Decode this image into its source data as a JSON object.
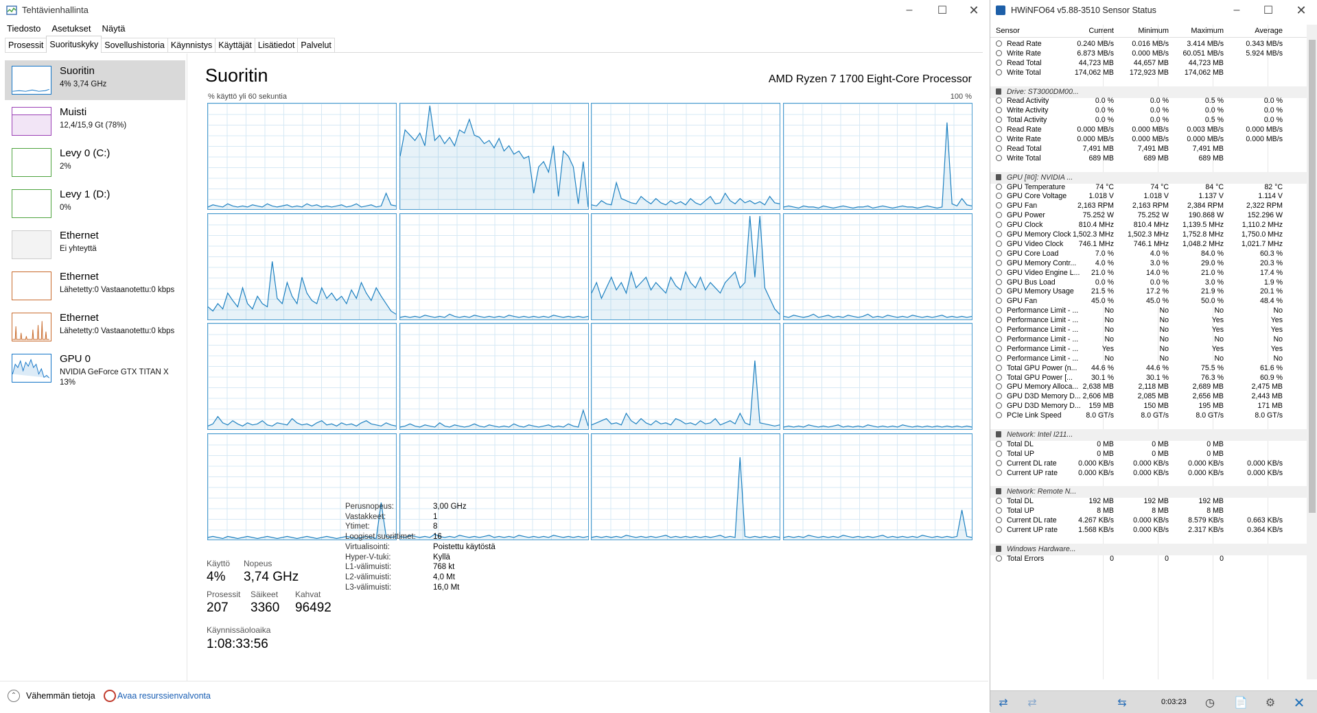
{
  "task_manager": {
    "title": "Tehtävienhallinta",
    "menu": [
      "Tiedosto",
      "Asetukset",
      "Näytä"
    ],
    "tabs": [
      "Prosessit",
      "Suorituskyky",
      "Sovellushistoria",
      "Käynnistys",
      "Käyttäjät",
      "Lisätiedot",
      "Palvelut"
    ],
    "resources": [
      {
        "name": "Suoritin",
        "sub": "4% 3,74 GHz",
        "color": "#1174c7"
      },
      {
        "name": "Muisti",
        "sub": "12,4/15,9 Gt (78%)",
        "color": "#9b3fb5"
      },
      {
        "name": "Levy 0 (C:)",
        "sub": "2%",
        "color": "#4da33d"
      },
      {
        "name": "Levy 1 (D:)",
        "sub": "0%",
        "color": "#4da33d"
      },
      {
        "name": "Ethernet",
        "sub": "Ei yhteyttä",
        "color": "#bbbbbb"
      },
      {
        "name": "Ethernet",
        "sub": "Lähetetty:0 Vastaanotettu:0 kbps",
        "color": "#c8692a"
      },
      {
        "name": "Ethernet",
        "sub": "Lähetetty:0 Vastaanotettu:0 kbps",
        "color": "#c8692a"
      },
      {
        "name": "GPU 0",
        "sub": "NVIDIA GeForce GTX TITAN X",
        "sub2": "13%",
        "color": "#1174c7"
      }
    ],
    "cpu": {
      "title": "Suoritin",
      "model": "AMD Ryzen 7 1700 Eight-Core Processor",
      "graph_caption": "% käyttö yli 60 sekuntia",
      "graph_max": "100 %",
      "stats": {
        "usage_label": "Käyttö",
        "usage": "4%",
        "speed_label": "Nopeus",
        "speed": "3,74 GHz",
        "processes_label": "Prosessit",
        "processes": "207",
        "threads_label": "Säikeet",
        "threads": "3360",
        "handles_label": "Kahvat",
        "handles": "96492",
        "uptime_label": "Käynnissäoloaika",
        "uptime": "1:08:33:56"
      },
      "details": [
        [
          "Perusnopeus:",
          "3,00 GHz"
        ],
        [
          "Vastakkeet:",
          "1"
        ],
        [
          "Ytimet:",
          "8"
        ],
        [
          "Loogiset suorittimet:",
          "16"
        ],
        [
          "Virtualisointi:",
          "Poistettu käytöstä"
        ],
        [
          "Hyper-V-tuki:",
          "Kyllä"
        ],
        [
          "L1-välimuisti:",
          "768 kt"
        ],
        [
          "L2-välimuisti:",
          "4,0 Mt"
        ],
        [
          "L3-välimuisti:",
          "16,0 Mt"
        ]
      ],
      "core_usage_series": [
        [
          2,
          4,
          3,
          2,
          5,
          3,
          2,
          3,
          2,
          4,
          3,
          2,
          5,
          3,
          2,
          3,
          4,
          2,
          3,
          2,
          5,
          3,
          4,
          2,
          3,
          2,
          3,
          4,
          2,
          3,
          5,
          2,
          3,
          4,
          2,
          3,
          15,
          4,
          3
        ],
        [
          50,
          75,
          70,
          65,
          72,
          60,
          98,
          65,
          70,
          62,
          68,
          60,
          75,
          72,
          85,
          70,
          68,
          62,
          65,
          58,
          67,
          55,
          60,
          52,
          55,
          48,
          50,
          15,
          40,
          45,
          35,
          60,
          12,
          55,
          50,
          40,
          5,
          45,
          2
        ],
        [
          4,
          3,
          8,
          5,
          4,
          25,
          10,
          8,
          6,
          5,
          12,
          8,
          5,
          10,
          6,
          4,
          8,
          5,
          7,
          4,
          10,
          6,
          4,
          8,
          12,
          5,
          6,
          15,
          8,
          5,
          10,
          6,
          8,
          5,
          7,
          4,
          12,
          6,
          5
        ],
        [
          2,
          3,
          2,
          1,
          3,
          2,
          2,
          1,
          3,
          2,
          1,
          2,
          3,
          2,
          1,
          2,
          2,
          3,
          1,
          2,
          3,
          2,
          1,
          2,
          3,
          2,
          2,
          1,
          2,
          3,
          2,
          1,
          2,
          82,
          5,
          3,
          10,
          4,
          3
        ],
        [
          12,
          8,
          15,
          10,
          25,
          18,
          12,
          30,
          15,
          10,
          22,
          15,
          12,
          55,
          20,
          15,
          35,
          22,
          15,
          40,
          25,
          18,
          15,
          30,
          20,
          25,
          18,
          22,
          15,
          28,
          20,
          35,
          25,
          18,
          30,
          22,
          15,
          8,
          5
        ],
        [
          2,
          3,
          2,
          3,
          2,
          4,
          3,
          2,
          3,
          2,
          5,
          3,
          2,
          3,
          2,
          4,
          3,
          2,
          3,
          2,
          3,
          2,
          4,
          3,
          2,
          3,
          2,
          3,
          2,
          3,
          2,
          4,
          3,
          2,
          3,
          2,
          3,
          2,
          3
        ],
        [
          25,
          35,
          20,
          30,
          40,
          28,
          35,
          25,
          45,
          30,
          35,
          40,
          28,
          35,
          30,
          25,
          40,
          32,
          28,
          45,
          35,
          30,
          40,
          28,
          35,
          30,
          25,
          35,
          40,
          45,
          30,
          35,
          98,
          40,
          98,
          30,
          20,
          10,
          5
        ],
        [
          3,
          2,
          4,
          3,
          2,
          3,
          5,
          2,
          3,
          4,
          2,
          3,
          2,
          4,
          3,
          2,
          3,
          5,
          2,
          3,
          2,
          4,
          3,
          2,
          3,
          2,
          4,
          3,
          2,
          3,
          2,
          3,
          4,
          2,
          3,
          2,
          3,
          2,
          3
        ],
        [
          3,
          5,
          12,
          6,
          4,
          8,
          5,
          3,
          6,
          4,
          5,
          8,
          4,
          3,
          6,
          5,
          4,
          10,
          6,
          4,
          5,
          3,
          6,
          8,
          4,
          5,
          3,
          6,
          4,
          5,
          3,
          6,
          8,
          5,
          4,
          3,
          6,
          4,
          3
        ],
        [
          2,
          3,
          5,
          3,
          2,
          4,
          3,
          2,
          6,
          3,
          2,
          4,
          3,
          2,
          3,
          5,
          3,
          2,
          4,
          3,
          2,
          3,
          2,
          5,
          3,
          2,
          4,
          3,
          2,
          3,
          4,
          2,
          3,
          2,
          5,
          3,
          2,
          18,
          3
        ],
        [
          4,
          6,
          8,
          10,
          5,
          6,
          4,
          15,
          8,
          5,
          10,
          6,
          4,
          8,
          5,
          6,
          4,
          10,
          8,
          5,
          6,
          4,
          8,
          5,
          6,
          10,
          4,
          6,
          8,
          5,
          15,
          6,
          4,
          65,
          6,
          5,
          4,
          3,
          4
        ],
        [
          2,
          3,
          2,
          3,
          2,
          4,
          3,
          2,
          3,
          2,
          3,
          4,
          2,
          3,
          2,
          3,
          2,
          4,
          3,
          2,
          3,
          2,
          3,
          2,
          4,
          3,
          2,
          3,
          2,
          3,
          2,
          3,
          2,
          3,
          2,
          3,
          2,
          3,
          2
        ],
        [
          2,
          3,
          2,
          1,
          3,
          2,
          1,
          2,
          3,
          2,
          1,
          2,
          3,
          2,
          1,
          2,
          3,
          2,
          1,
          2,
          3,
          2,
          1,
          2,
          3,
          2,
          1,
          2,
          3,
          2,
          1,
          2,
          3,
          2,
          1,
          35,
          3,
          2,
          3
        ],
        [
          3,
          2,
          4,
          3,
          2,
          3,
          2,
          5,
          3,
          2,
          3,
          2,
          4,
          3,
          2,
          3,
          2,
          3,
          4,
          2,
          3,
          2,
          3,
          2,
          4,
          3,
          2,
          3,
          2,
          3,
          2,
          4,
          3,
          2,
          3,
          2,
          3,
          2,
          3
        ],
        [
          2,
          3,
          2,
          3,
          2,
          3,
          2,
          4,
          3,
          2,
          3,
          2,
          3,
          2,
          3,
          4,
          2,
          3,
          2,
          3,
          2,
          3,
          2,
          3,
          2,
          3,
          4,
          2,
          3,
          2,
          78,
          3,
          2,
          3,
          2,
          3,
          2,
          3,
          2
        ],
        [
          2,
          3,
          2,
          3,
          2,
          4,
          3,
          2,
          3,
          2,
          3,
          2,
          4,
          3,
          2,
          3,
          2,
          3,
          2,
          3,
          4,
          2,
          3,
          2,
          3,
          2,
          3,
          2,
          4,
          3,
          2,
          3,
          2,
          3,
          2,
          3,
          28,
          3,
          2
        ]
      ]
    },
    "footer": {
      "less": "Vähemmän tietoja",
      "monitor": "Avaa resurssienvalvonta"
    }
  },
  "hwinfo": {
    "title": "HWiNFO64 v5.88-3510 Sensor Status",
    "headers": [
      "Sensor",
      "Current",
      "Minimum",
      "Maximum",
      "Average"
    ],
    "rows": [
      [
        "Read Rate",
        "0.240 MB/s",
        "0.016 MB/s",
        "3.414 MB/s",
        "0.343 MB/s"
      ],
      [
        "Write Rate",
        "6.873 MB/s",
        "0.000 MB/s",
        "60.051 MB/s",
        "5.924 MB/s"
      ],
      [
        "Read Total",
        "44,723 MB",
        "44,657 MB",
        "44,723 MB",
        ""
      ],
      [
        "Write Total",
        "174,062 MB",
        "172,923 MB",
        "174,062 MB",
        ""
      ],
      [],
      [
        "Drive: ST3000DM00..."
      ],
      [
        "Read Activity",
        "0.0 %",
        "0.0 %",
        "0.5 %",
        "0.0 %"
      ],
      [
        "Write Activity",
        "0.0 %",
        "0.0 %",
        "0.0 %",
        "0.0 %"
      ],
      [
        "Total Activity",
        "0.0 %",
        "0.0 %",
        "0.5 %",
        "0.0 %"
      ],
      [
        "Read Rate",
        "0.000 MB/s",
        "0.000 MB/s",
        "0.003 MB/s",
        "0.000 MB/s"
      ],
      [
        "Write Rate",
        "0.000 MB/s",
        "0.000 MB/s",
        "0.000 MB/s",
        "0.000 MB/s"
      ],
      [
        "Read Total",
        "7,491 MB",
        "7,491 MB",
        "7,491 MB",
        ""
      ],
      [
        "Write Total",
        "689 MB",
        "689 MB",
        "689 MB",
        ""
      ],
      [],
      [
        "GPU [#0]: NVIDIA ..."
      ],
      [
        "GPU Temperature",
        "74 °C",
        "74 °C",
        "84 °C",
        "82 °C"
      ],
      [
        "GPU Core Voltage",
        "1.018 V",
        "1.018 V",
        "1.137 V",
        "1.114 V"
      ],
      [
        "GPU Fan",
        "2,163 RPM",
        "2,163 RPM",
        "2,384 RPM",
        "2,322 RPM"
      ],
      [
        "GPU Power",
        "75.252 W",
        "75.252 W",
        "190.868 W",
        "152.296 W"
      ],
      [
        "GPU Clock",
        "810.4 MHz",
        "810.4 MHz",
        "1,139.5 MHz",
        "1,110.2 MHz"
      ],
      [
        "GPU Memory Clock",
        "1,502.3 MHz",
        "1,502.3 MHz",
        "1,752.8 MHz",
        "1,750.0 MHz"
      ],
      [
        "GPU Video Clock",
        "746.1 MHz",
        "746.1 MHz",
        "1,048.2 MHz",
        "1,021.7 MHz"
      ],
      [
        "GPU Core Load",
        "7.0 %",
        "4.0 %",
        "84.0 %",
        "60.3 %"
      ],
      [
        "GPU Memory Contr...",
        "4.0 %",
        "3.0 %",
        "29.0 %",
        "20.3 %"
      ],
      [
        "GPU Video Engine L...",
        "21.0 %",
        "14.0 %",
        "21.0 %",
        "17.4 %"
      ],
      [
        "GPU Bus Load",
        "0.0 %",
        "0.0 %",
        "3.0 %",
        "1.9 %"
      ],
      [
        "GPU Memory Usage",
        "21.5 %",
        "17.2 %",
        "21.9 %",
        "20.1 %"
      ],
      [
        "GPU Fan",
        "45.0 %",
        "45.0 %",
        "50.0 %",
        "48.4 %"
      ],
      [
        "Performance Limit - ...",
        "No",
        "No",
        "No",
        "No"
      ],
      [
        "Performance Limit - ...",
        "No",
        "No",
        "Yes",
        "Yes"
      ],
      [
        "Performance Limit - ...",
        "No",
        "No",
        "Yes",
        "Yes"
      ],
      [
        "Performance Limit - ...",
        "No",
        "No",
        "No",
        "No"
      ],
      [
        "Performance Limit - ...",
        "Yes",
        "No",
        "Yes",
        "Yes"
      ],
      [
        "Performance Limit - ...",
        "No",
        "No",
        "No",
        "No"
      ],
      [
        "Total GPU Power (n...",
        "44.6 %",
        "44.6 %",
        "75.5 %",
        "61.6 %"
      ],
      [
        "Total GPU Power [...",
        "30.1 %",
        "30.1 %",
        "76.3 %",
        "60.9 %"
      ],
      [
        "GPU Memory Alloca...",
        "2,638 MB",
        "2,118 MB",
        "2,689 MB",
        "2,475 MB"
      ],
      [
        "GPU D3D Memory D...",
        "2,606 MB",
        "2,085 MB",
        "2,656 MB",
        "2,443 MB"
      ],
      [
        "GPU D3D Memory D...",
        "159 MB",
        "150 MB",
        "195 MB",
        "171 MB"
      ],
      [
        "PCIe Link Speed",
        "8.0 GT/s",
        "8.0 GT/s",
        "8.0 GT/s",
        "8.0 GT/s"
      ],
      [],
      [
        "Network: Intel I211..."
      ],
      [
        "Total DL",
        "0 MB",
        "0 MB",
        "0 MB",
        ""
      ],
      [
        "Total UP",
        "0 MB",
        "0 MB",
        "0 MB",
        ""
      ],
      [
        "Current DL rate",
        "0.000 KB/s",
        "0.000 KB/s",
        "0.000 KB/s",
        "0.000 KB/s"
      ],
      [
        "Current UP rate",
        "0.000 KB/s",
        "0.000 KB/s",
        "0.000 KB/s",
        "0.000 KB/s"
      ],
      [],
      [
        "Network: Remote N..."
      ],
      [
        "Total DL",
        "192 MB",
        "192 MB",
        "192 MB",
        ""
      ],
      [
        "Total UP",
        "8 MB",
        "8 MB",
        "8 MB",
        ""
      ],
      [
        "Current DL rate",
        "4.267 KB/s",
        "0.000 KB/s",
        "8.579 KB/s",
        "0.663 KB/s"
      ],
      [
        "Current UP rate",
        "1.568 KB/s",
        "0.000 KB/s",
        "2.317 KB/s",
        "0.364 KB/s"
      ],
      [],
      [
        "Windows Hardware..."
      ],
      [
        "Total Errors",
        "0",
        "0",
        "0",
        ""
      ]
    ],
    "timer": "0:03:23"
  }
}
